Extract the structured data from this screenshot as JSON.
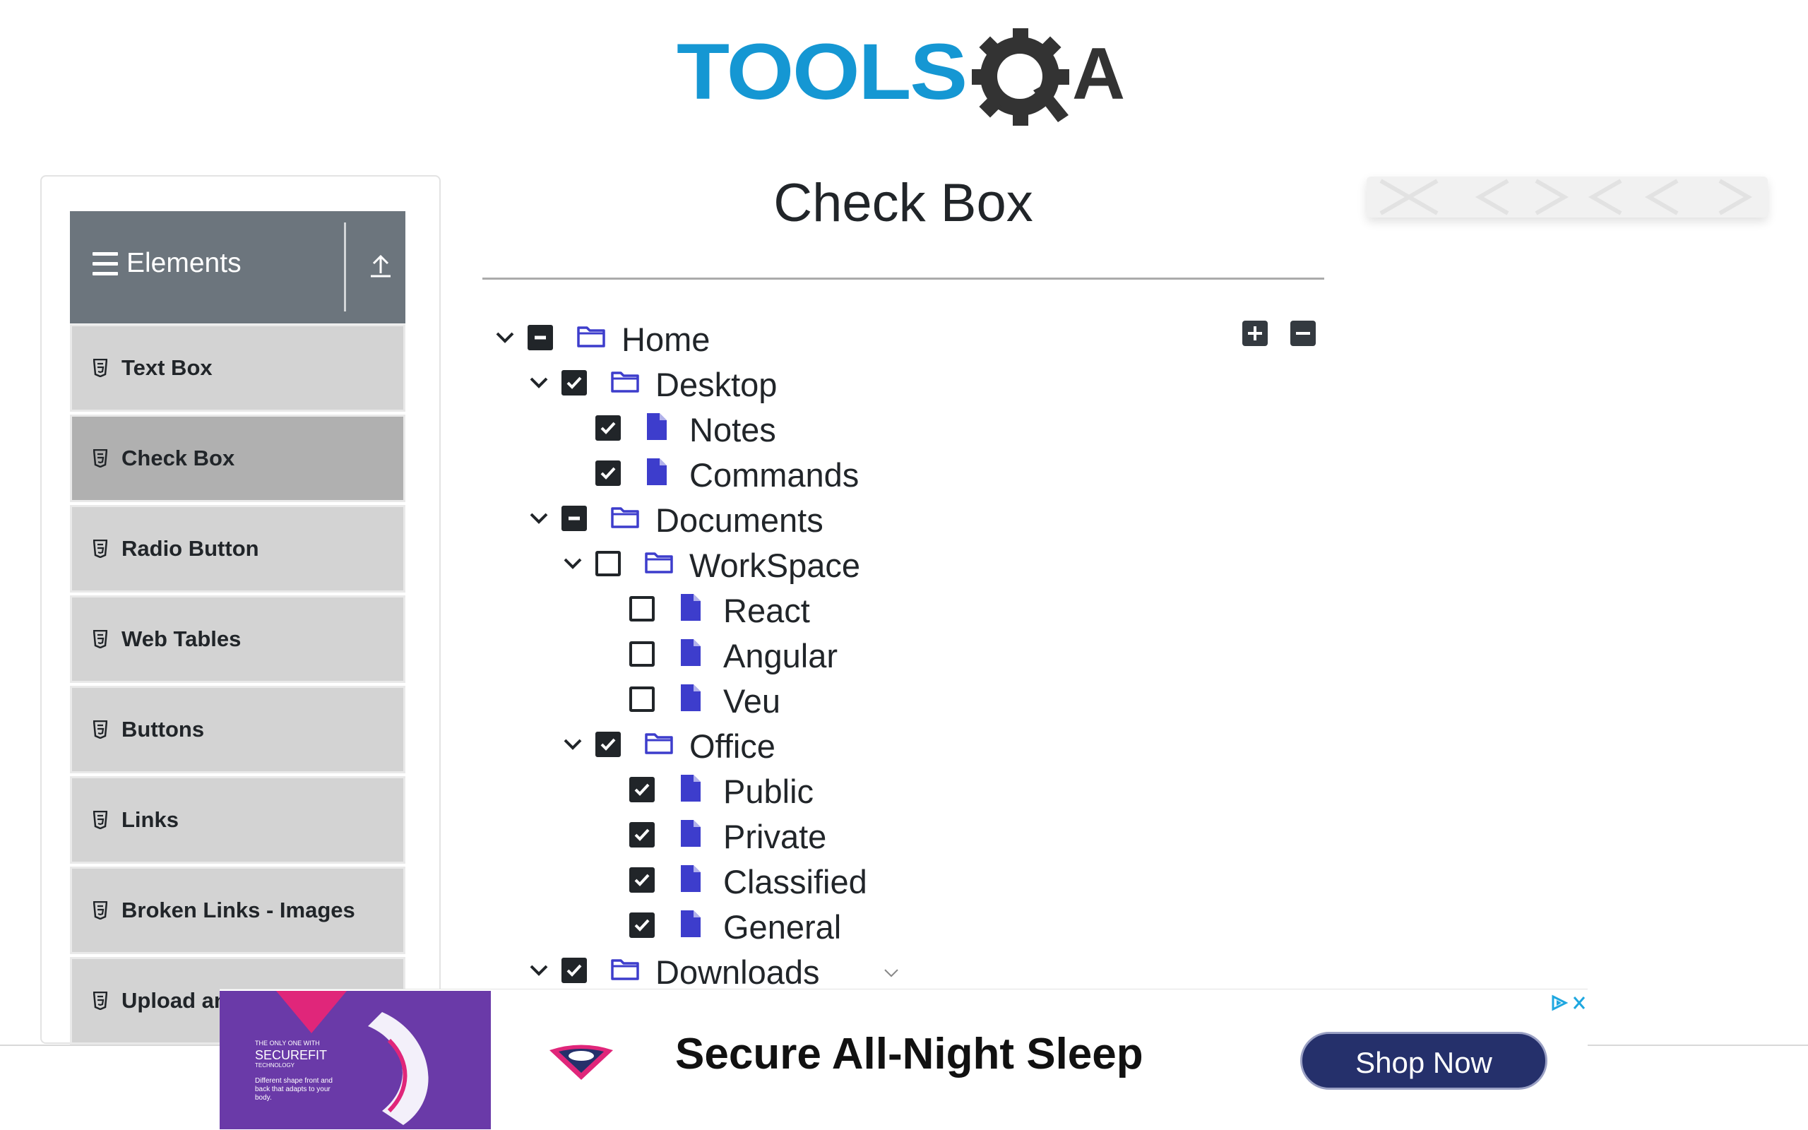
{
  "header": {
    "logo": {
      "text_left": "TOOLS",
      "text_right": "A",
      "colors": {
        "blue": "#1597d3",
        "dark": "#333333"
      }
    }
  },
  "sidebar": {
    "group": {
      "title": "Elements",
      "icons": [
        "menu-icon",
        "collapse-arrow-icon"
      ]
    },
    "items": [
      {
        "label": "Text Box",
        "active": false
      },
      {
        "label": "Check Box",
        "active": true
      },
      {
        "label": "Radio Button",
        "active": false
      },
      {
        "label": "Web Tables",
        "active": false
      },
      {
        "label": "Buttons",
        "active": false
      },
      {
        "label": "Links",
        "active": false
      },
      {
        "label": "Broken Links - Images",
        "active": false
      },
      {
        "label": "Upload and Download",
        "active": false
      }
    ]
  },
  "main": {
    "title": "Check Box",
    "tree_controls": {
      "expand_all": "plus-icon",
      "collapse_all": "minus-icon"
    },
    "tree": [
      {
        "label": "Home",
        "level": 0,
        "type": "folder",
        "state": "half",
        "expanded": true
      },
      {
        "label": "Desktop",
        "level": 1,
        "type": "folder",
        "state": "checked",
        "expanded": true
      },
      {
        "label": "Notes",
        "level": 2,
        "type": "file",
        "state": "checked"
      },
      {
        "label": "Commands",
        "level": 2,
        "type": "file",
        "state": "checked"
      },
      {
        "label": "Documents",
        "level": 1,
        "type": "folder",
        "state": "half",
        "expanded": true
      },
      {
        "label": "WorkSpace",
        "level": 2,
        "type": "folder",
        "state": "unchecked",
        "expanded": true
      },
      {
        "label": "React",
        "level": 3,
        "type": "file",
        "state": "unchecked"
      },
      {
        "label": "Angular",
        "level": 3,
        "type": "file",
        "state": "unchecked"
      },
      {
        "label": "Veu",
        "level": 3,
        "type": "file",
        "state": "unchecked"
      },
      {
        "label": "Office",
        "level": 2,
        "type": "folder",
        "state": "checked",
        "expanded": true
      },
      {
        "label": "Public",
        "level": 3,
        "type": "file",
        "state": "checked"
      },
      {
        "label": "Private",
        "level": 3,
        "type": "file",
        "state": "checked"
      },
      {
        "label": "Classified",
        "level": 3,
        "type": "file",
        "state": "checked"
      },
      {
        "label": "General",
        "level": 3,
        "type": "file",
        "state": "checked"
      },
      {
        "label": "Downloads",
        "level": 1,
        "type": "folder",
        "state": "checked",
        "expanded": true
      }
    ],
    "colors": {
      "icon": "#3d3dcc",
      "checkbox": "#212529"
    }
  },
  "ad": {
    "headline": "Secure All-Night Sleep",
    "cta": "Shop Now",
    "image_text": {
      "line1": "THE ONLY ONE WITH",
      "brand": "SECUREFIT",
      "line2": "TECHNOLOGY",
      "body": "Different shape front and back that adapts to your body."
    },
    "logo_name": "brand-logo-icon",
    "choices_icons": [
      "adchoices-icon",
      "close-icon"
    ],
    "colors": {
      "cta_bg": "#25306b",
      "image_bg": "#6a3aa8"
    }
  }
}
